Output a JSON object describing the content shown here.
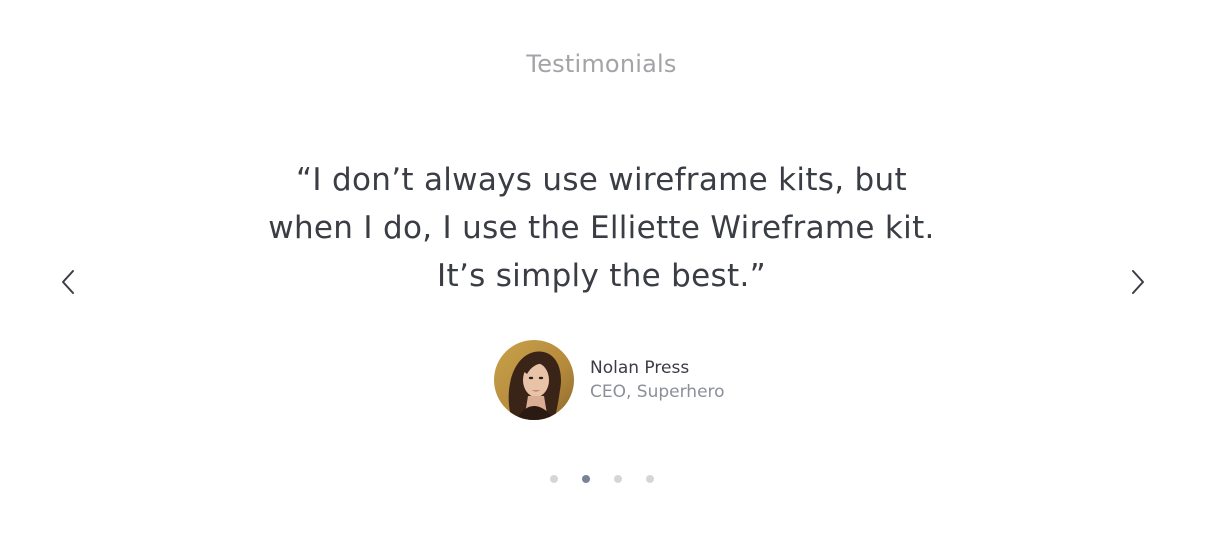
{
  "testimonials": {
    "heading": "Testimonials",
    "quote_lines": [
      "“I don’t always use wireframe kits, but",
      "when I do, I use the Elliette Wireframe kit.",
      "It’s simply the best.”"
    ],
    "author": {
      "name": "Nolan Press",
      "role": "CEO, Superhero",
      "avatar_icon": "person-portrait"
    },
    "nav": {
      "prev_icon": "chevron-left-icon",
      "next_icon": "chevron-right-icon"
    },
    "pagination": {
      "count": 4,
      "active_index": 1
    }
  },
  "colors": {
    "heading": "#a3a3a8",
    "quote_text": "#3b3d44",
    "role_text": "#8b8f99",
    "dot_inactive": "#d6d6d9",
    "dot_active": "#7a8299"
  }
}
